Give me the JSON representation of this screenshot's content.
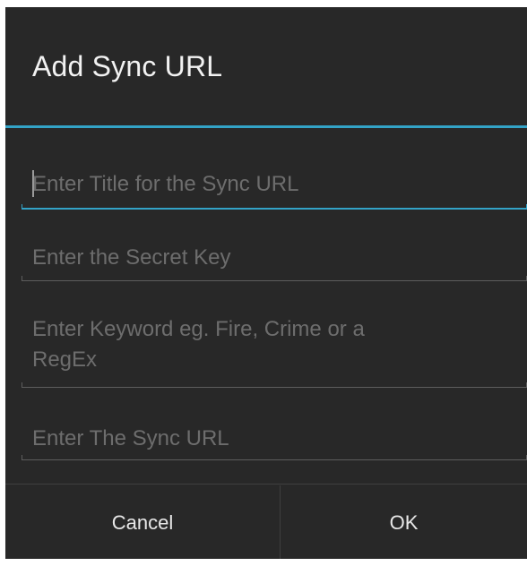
{
  "dialog": {
    "title": "Add Sync URL",
    "fields": [
      {
        "placeholder": "Enter Title for the Sync URL",
        "value": "",
        "focused": true
      },
      {
        "placeholder": "Enter the Secret Key",
        "value": ""
      },
      {
        "placeholder_line1": "Enter Keyword eg. Fire, Crime or a",
        "placeholder_line2": "RegEx",
        "value": ""
      },
      {
        "placeholder": "Enter The Sync URL",
        "value": ""
      }
    ],
    "buttons": {
      "cancel": "Cancel",
      "ok": "OK"
    }
  },
  "colors": {
    "dialog_background": "#282828",
    "accent": "#33a3c7",
    "hint_text": "#6d6d6d",
    "title_text": "#f2f2f2"
  }
}
